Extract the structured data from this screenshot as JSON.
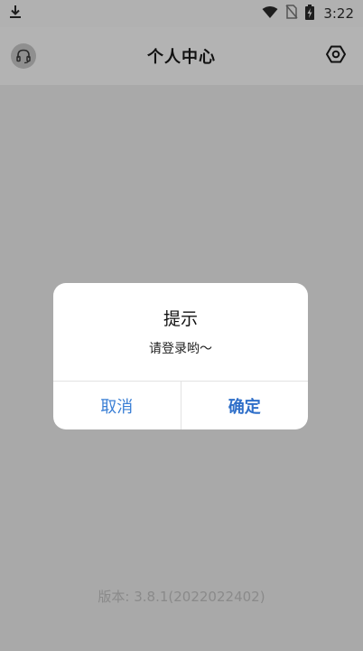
{
  "status_bar": {
    "time": "3:22"
  },
  "header": {
    "title": "个人中心"
  },
  "dialog": {
    "title": "提示",
    "message": "请登录哟～",
    "cancel_label": "取消",
    "confirm_label": "确定"
  },
  "footer": {
    "version": "版本: 3.8.1(2022022402)"
  },
  "colors": {
    "accent": "#3a7fd5",
    "overlay": "#a9a9a9",
    "dialog_bg": "#ffffff"
  }
}
